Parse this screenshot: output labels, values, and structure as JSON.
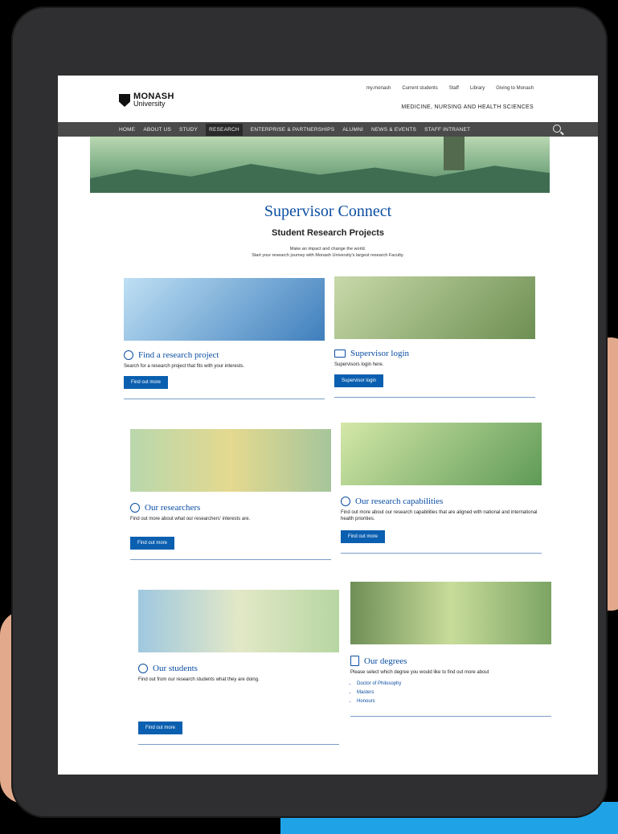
{
  "header": {
    "logo_line1": "MONASH",
    "logo_line2": "University",
    "utility_links": [
      "my.monash",
      "Current students",
      "Staff",
      "Library",
      "Giving to Monash"
    ],
    "faculty": "MEDICINE, NURSING AND HEALTH SCIENCES"
  },
  "nav": {
    "items": [
      "HOME",
      "ABOUT US",
      "STUDY",
      "RESEARCH",
      "ENTERPRISE & PARTNERSHIPS",
      "ALUMNI",
      "NEWS & EVENTS",
      "STAFF INTRANET"
    ],
    "active": "RESEARCH"
  },
  "page": {
    "title": "Supervisor Connect",
    "subtitle": "Student Research Projects",
    "intro_line1": "Make an impact and change the world.",
    "intro_line2": "Start your research journey with Monash University's largest research Faculty."
  },
  "cards": [
    {
      "title": "Find a research project",
      "text": "Search for a research project that fits with your interests.",
      "button": "Find out more",
      "icon": "search-icon"
    },
    {
      "title": "Supervisor login",
      "text": "Supervisors login here.",
      "button": "Supervisor login",
      "icon": "laptop-icon"
    },
    {
      "title": "Our researchers",
      "text": "Find out more about what our researchers' interests are.",
      "button": "Find out more",
      "icon": "target-icon"
    },
    {
      "title": "Our research capabilities",
      "text": "Find out more about our research capabilities that are aligned with national and international health priorities.",
      "button": "Find out more",
      "icon": "biohazard-icon"
    },
    {
      "title": "Our students",
      "text": "Find out from our research students what they are doing.",
      "button": "Find out more",
      "icon": "people-icon"
    },
    {
      "title": "Our degrees",
      "text": "Please select which degree you would like to find out more about",
      "button": "",
      "icon": "book-icon",
      "list": [
        "Doctor of Philosophy",
        "Masters",
        "Honours"
      ]
    }
  ],
  "colors": {
    "brand_blue": "#0b4ea2",
    "button": "#0b5fb0",
    "nav": "#4a4a4a"
  }
}
